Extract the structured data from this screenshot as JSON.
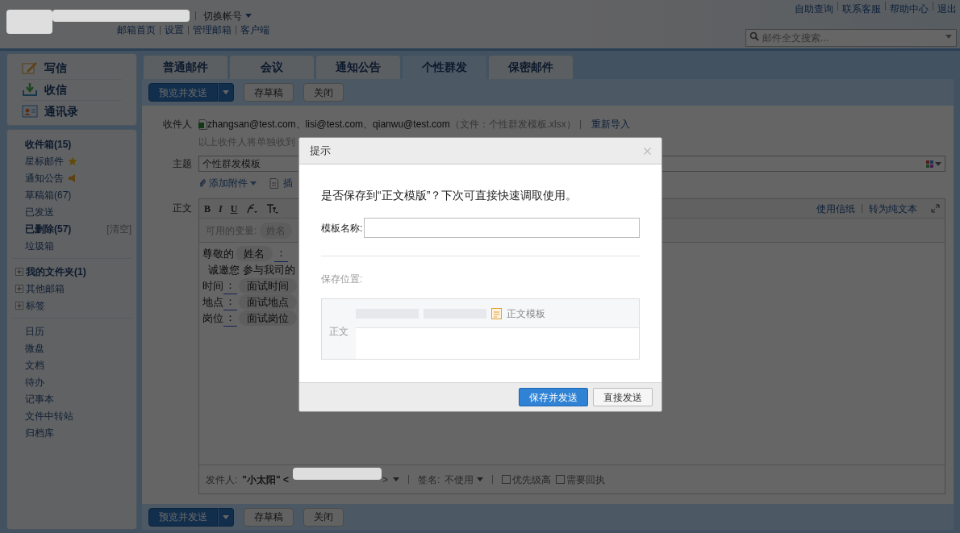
{
  "header": {
    "switch_account": "切换帐号",
    "nav_links": [
      "邮箱首页",
      "设置",
      "管理邮箱",
      "客户端"
    ],
    "top_links": [
      "自助查询",
      "联系客服",
      "帮助中心",
      "退出"
    ],
    "search": {
      "placeholder": "邮件全文搜索..."
    }
  },
  "sidebar": {
    "actions": [
      {
        "label": "写信",
        "kind": "compose"
      },
      {
        "label": "收信",
        "kind": "inbox"
      },
      {
        "label": "通讯录",
        "kind": "contacts"
      }
    ],
    "folders": [
      {
        "label": "收件箱(15)",
        "bold": true
      },
      {
        "label": "星标邮件",
        "bold": false,
        "kind": "star"
      },
      {
        "label": "通知公告",
        "bold": false,
        "kind": "notice"
      },
      {
        "label": "草稿箱(67)",
        "bold": false
      },
      {
        "label": "已发送",
        "bold": false
      },
      {
        "label": "已删除(57)",
        "bold": true,
        "action": "[清空]"
      },
      {
        "label": "垃圾箱",
        "bold": false
      }
    ],
    "groups": [
      {
        "label": "我的文件夹(1)",
        "bold": true,
        "expanded": false
      },
      {
        "label": "其他邮箱",
        "bold": false,
        "expanded": false
      },
      {
        "label": "标签",
        "bold": false,
        "expanded": false
      }
    ],
    "tools": [
      "日历",
      "微盘",
      "文档",
      "待办",
      "记事本",
      "文件中转站",
      "归档库"
    ]
  },
  "tabs": [
    {
      "label": "普通邮件",
      "selected": false
    },
    {
      "label": "会议",
      "selected": false
    },
    {
      "label": "通知公告",
      "selected": false
    },
    {
      "label": "个性群发",
      "selected": true
    },
    {
      "label": "保密邮件",
      "selected": false
    }
  ],
  "top_toolbar": {
    "send": "预览并发送",
    "buttons": [
      "存草稿",
      "关闭"
    ]
  },
  "bottom_toolbar": {
    "send": "预览并发送",
    "buttons": [
      "存草稿",
      "关闭"
    ]
  },
  "compose": {
    "recipients_label": "收件人",
    "recipients": "zhangsan@test.com、lisi@test.com、qianwu@test.com",
    "file_note": "（文件：个性群发模板.xlsx）",
    "reimport": "重新导入",
    "recipients_hint": "以上收件人将单独收到",
    "subject_label": "主题",
    "subject": "个性群发模板",
    "attach": "添加附件",
    "insert": "插",
    "body_label": "正文",
    "format_buttons": [
      "B",
      "I",
      "U"
    ],
    "editor_links": [
      "使用信纸",
      "转为纯文本"
    ],
    "variables_label": "可用的变量:",
    "variables": [
      "姓名"
    ],
    "body_lines": [
      [
        {
          "kind": "text",
          "text": "尊敬的"
        },
        {
          "kind": "var",
          "text": "姓名"
        },
        {
          "kind": "mark",
          "text": "："
        }
      ],
      [
        {
          "kind": "text",
          "text": "  诚邀您 参与我司的"
        }
      ],
      [
        {
          "kind": "text",
          "text": "时间"
        },
        {
          "kind": "mark",
          "text": "："
        },
        {
          "kind": "var",
          "text": "面试时间"
        }
      ],
      [
        {
          "kind": "text",
          "text": "地点"
        },
        {
          "kind": "mark",
          "text": "："
        },
        {
          "kind": "var",
          "text": "面试地点"
        }
      ],
      [
        {
          "kind": "text",
          "text": "岗位"
        },
        {
          "kind": "mark",
          "text": "："
        },
        {
          "kind": "var",
          "text": "面试岗位"
        }
      ]
    ],
    "sender_label": "发件人:",
    "sender_name": "\"小太阳\" <",
    "sender_end": ">",
    "signature_label": "签名:",
    "signature": "不使用",
    "options": [
      {
        "label": "优先级高",
        "checked": false
      },
      {
        "label": "需要回执",
        "checked": false
      }
    ]
  },
  "dialog": {
    "title": "提示",
    "message": "是否保存到“正文模版”？下次可直接快速调取使用。",
    "name_label": "模板名称:",
    "location_label": "保存位置:",
    "folder": "正文模板",
    "row_label": "正文",
    "buttons": [
      {
        "label": "保存并发送",
        "kind": "primary"
      },
      {
        "label": "直接发送",
        "kind": "secondary"
      }
    ]
  }
}
